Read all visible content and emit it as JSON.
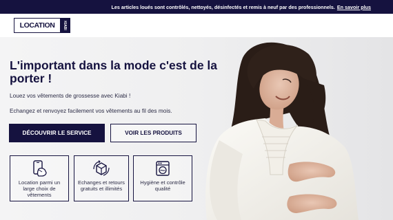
{
  "topbar": {
    "message": "Les articles loués sont contrôlés, nettoyés, désinfectés et remis à neuf par des professionnels.",
    "link": "En savoir plus"
  },
  "logo": {
    "text": "LOCATION",
    "tag": "KIABI"
  },
  "hero": {
    "title": "L'important dans la mode c'est de la porter !",
    "subtitle1": "Louez vos vêtements de grossesse avec Kiabi !",
    "subtitle2": "Echangez et renvoyez facilement vos vêtements au fil des mois.",
    "primary_button": "DÉCOUVRIR LE SERVICE",
    "secondary_button": "VOIR LES PRODUITS"
  },
  "features": [
    {
      "icon": "phone-hand-icon",
      "label": "Location parmi un large choix de vêtements"
    },
    {
      "icon": "box-return-icon",
      "label": "Echanges et retours gratuits et illimités"
    },
    {
      "icon": "washing-machine-icon",
      "label": "Hygiène et contrôle qualité"
    }
  ],
  "colors": {
    "brand": "#15123f",
    "background": "#f1f1f2"
  }
}
